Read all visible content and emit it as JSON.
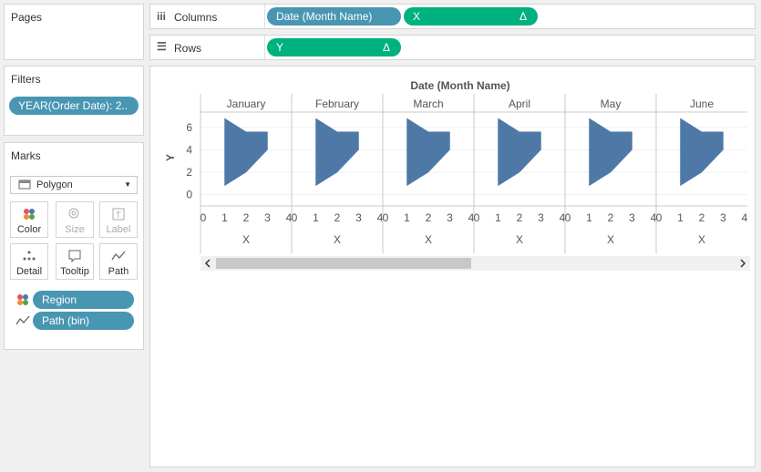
{
  "pages": {
    "title": "Pages"
  },
  "filters": {
    "title": "Filters",
    "pill": "YEAR(Order Date): 2.."
  },
  "marks": {
    "title": "Marks",
    "type": "Polygon",
    "buttons": [
      {
        "label": "Color",
        "icon": "color-dots-icon",
        "enabled": true
      },
      {
        "label": "Size",
        "icon": "size-icon",
        "enabled": false
      },
      {
        "label": "Label",
        "icon": "label-icon",
        "enabled": false
      },
      {
        "label": "Detail",
        "icon": "detail-dots-icon",
        "enabled": true
      },
      {
        "label": "Tooltip",
        "icon": "tooltip-icon",
        "enabled": true
      },
      {
        "label": "Path",
        "icon": "path-icon",
        "enabled": true
      }
    ],
    "fields": [
      {
        "label": "Region",
        "icon": "color-dots-icon"
      },
      {
        "label": "Path (bin)",
        "icon": "path-icon"
      }
    ]
  },
  "columns_shelf": {
    "label": "Columns",
    "pills": [
      {
        "text": "Date (Month Name)",
        "delta": ""
      },
      {
        "text": "X",
        "delta": "Δ"
      }
    ]
  },
  "rows_shelf": {
    "label": "Rows",
    "pills": [
      {
        "text": "Y",
        "delta": "Δ"
      }
    ]
  },
  "colors": {
    "mark": "#4e79a7",
    "blue_pill": "#4996b2",
    "green_pill": "#00b180"
  },
  "chart_data": {
    "type": "area",
    "title": "Date (Month Name)",
    "panels": [
      "January",
      "February",
      "March",
      "April",
      "May",
      "June"
    ],
    "xlabel": "X",
    "ylabel": "Y",
    "xticks": [
      0,
      1,
      2,
      3,
      4
    ],
    "yticks": [
      0,
      2,
      4,
      6
    ],
    "xlim": [
      0,
      4
    ],
    "ylim": [
      -0.6,
      7.2
    ],
    "polygon": [
      [
        1,
        6.8
      ],
      [
        2,
        5.6
      ],
      [
        3,
        5.6
      ],
      [
        3,
        4.0
      ],
      [
        2,
        2.0
      ],
      [
        1,
        0.8
      ]
    ]
  }
}
